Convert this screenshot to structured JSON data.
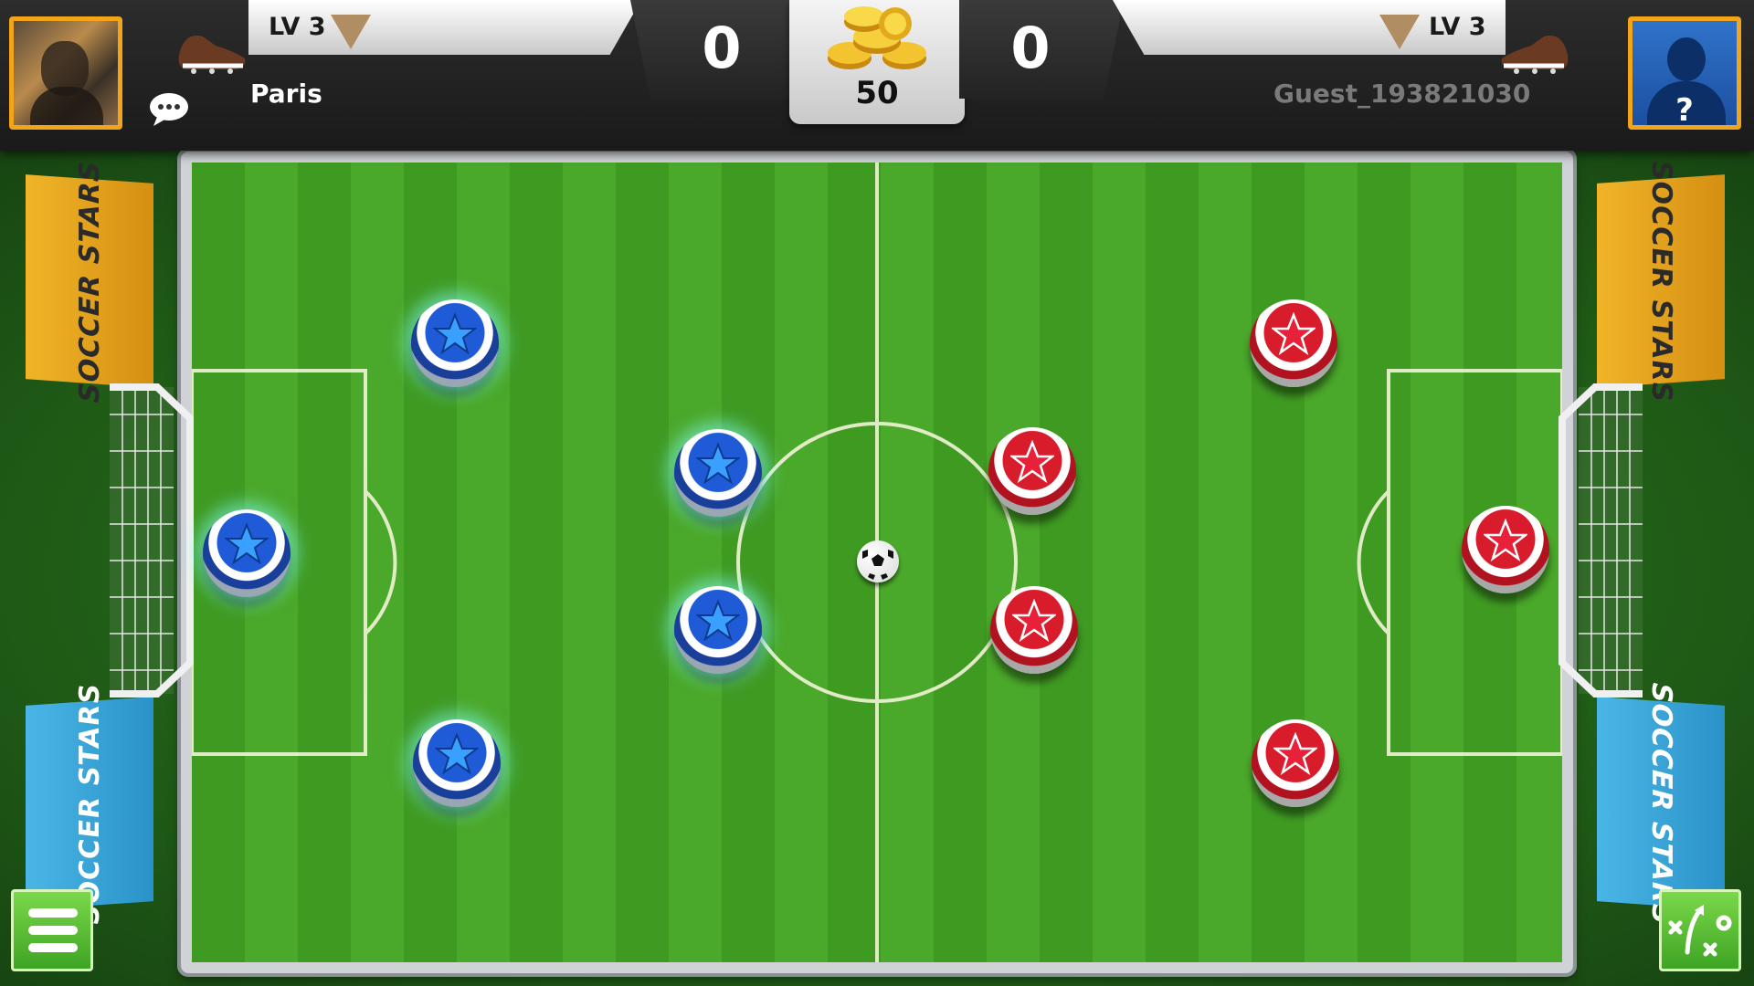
{
  "player1": {
    "name": "Paris",
    "level": "LV 3",
    "score": "0",
    "avatar": "player-photo"
  },
  "player2": {
    "name": "Guest_193821030",
    "level": "LV 3",
    "score": "0",
    "avatar": "unknown-user-icon"
  },
  "pot": {
    "coins": "50"
  },
  "banners": {
    "brand": "SOCCER STARS"
  },
  "teams": {
    "blue": "#1f5bd6",
    "red": "#d81c2c"
  },
  "icons": [
    "chat-bubble-icon",
    "soccer-boot-icon",
    "gold-coins-icon",
    "menu-icon",
    "tactics-icon"
  ]
}
